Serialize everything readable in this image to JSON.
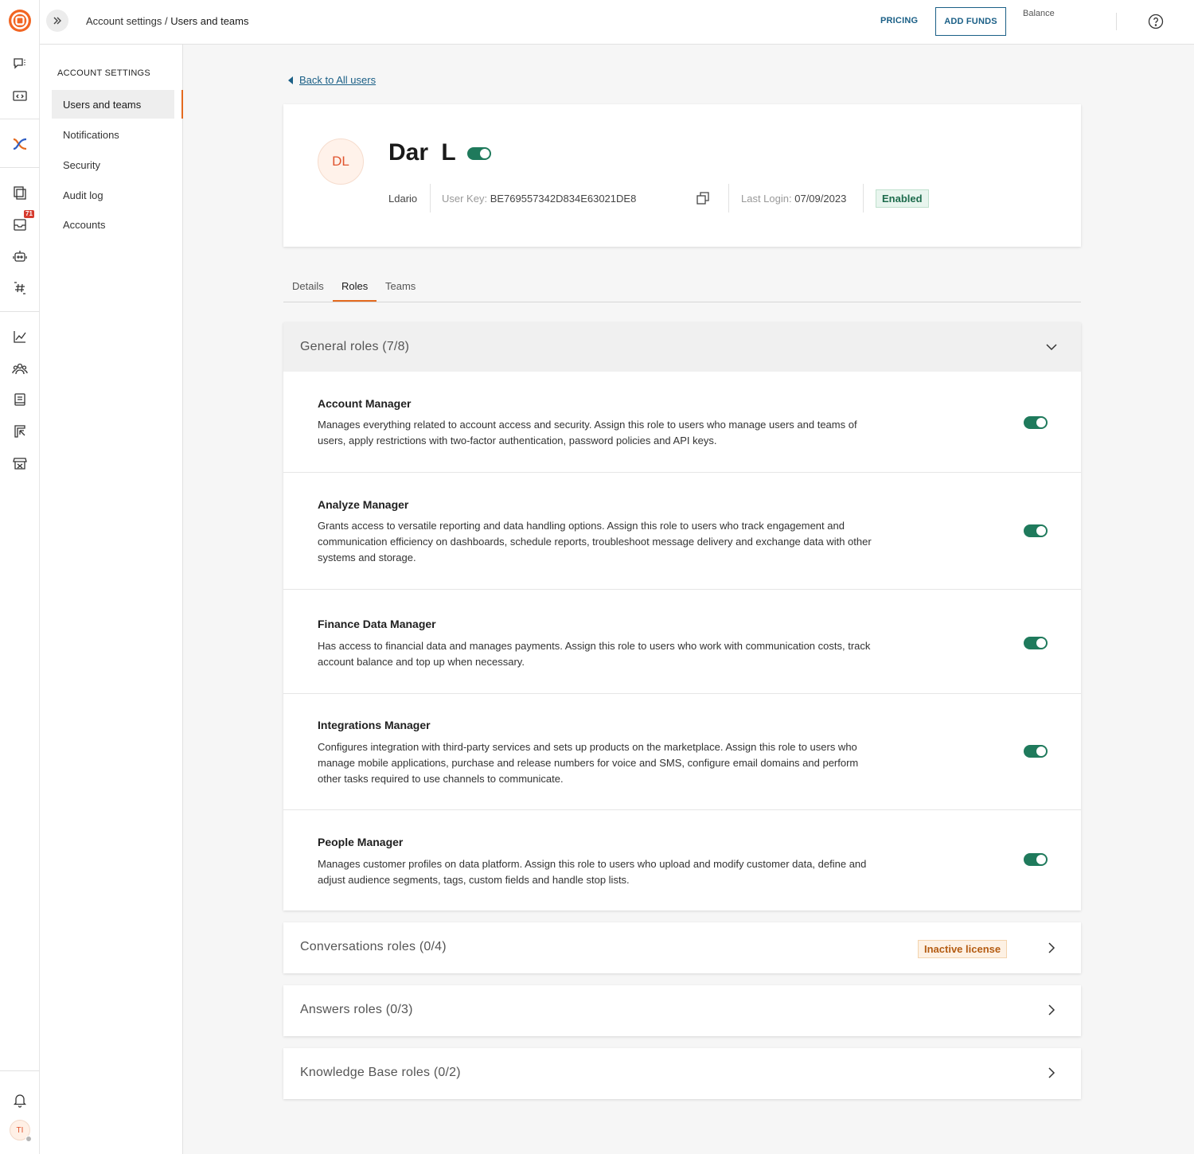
{
  "rail": {
    "icons": [
      "logo-icon",
      "conversations-icon",
      "developer-icon",
      "exchange-icon",
      "documents-icon",
      "inbox-icon",
      "bot-icon",
      "hashtag-icon",
      "analytics-icon",
      "people-icon",
      "knowledge-icon",
      "moments-icon",
      "marketplace-icon",
      "bell-icon"
    ],
    "badge": "71",
    "avatar_initials": "TI"
  },
  "topbar": {
    "breadcrumb_parent": "Account settings",
    "breadcrumb_separator": " / ",
    "breadcrumb_current": "Users and teams",
    "pricing": "PRICING",
    "add_funds": "ADD FUNDS",
    "balance_label": "Balance"
  },
  "sidebar": {
    "heading": "ACCOUNT SETTINGS",
    "items": [
      {
        "label": "Users and teams",
        "active": true
      },
      {
        "label": "Notifications"
      },
      {
        "label": "Security"
      },
      {
        "label": "Audit log"
      },
      {
        "label": "Accounts"
      }
    ]
  },
  "back_link": "Back to All users",
  "profile": {
    "initials": "DL",
    "name": "Dar L",
    "username": "Ldario",
    "user_key_label": "User Key:",
    "user_key": "BE769557342D834E63021DE8",
    "last_login_label": "Last Login:",
    "last_login": "07/09/2023",
    "status": "Enabled"
  },
  "tabs": [
    "Details",
    "Roles",
    "Teams"
  ],
  "active_tab": "Roles",
  "general_roles": {
    "title": "General roles (7/8)",
    "roles": [
      {
        "name": "Account Manager",
        "description": "Manages everything related to account access and security. Assign this role to users who manage users and teams of users, apply restrictions with two-factor authentication, password policies and API keys.",
        "enabled": true
      },
      {
        "name": "Analyze Manager",
        "description": "Grants access to versatile reporting and data handling options. Assign this role to users who track engagement and communication efficiency on dashboards, schedule reports, troubleshoot message delivery and exchange data with other systems and storage.",
        "enabled": true
      },
      {
        "name": "Finance Data Manager",
        "description": "Has access to financial data and manages payments. Assign this role to users who work with communication costs, track account balance and top up when necessary.",
        "enabled": true
      },
      {
        "name": "Integrations Manager",
        "description": "Configures integration with third-party services and sets up products on the marketplace. Assign this role to users who manage mobile applications, purchase and release numbers for voice and SMS, configure email domains and perform other tasks required to use channels to communicate.",
        "enabled": true
      },
      {
        "name": "People Manager",
        "description": "Manages customer profiles on data platform. Assign this role to users who upload and modify customer data, define and adjust audience segments, tags, custom fields and handle stop lists.",
        "enabled": true
      }
    ]
  },
  "other_groups": [
    {
      "title": "Conversations roles (0/4)",
      "badge": "Inactive license"
    },
    {
      "title": "Answers roles (0/3)"
    },
    {
      "title": "Knowledge Base roles (0/2)"
    }
  ],
  "colors": {
    "accent_orange": "#e46a1f",
    "link_blue": "#1a5f86",
    "toggle_green": "#1f7a5c",
    "enabled_bg": "#e8f5ee",
    "inactive_bg": "#fdf1e4"
  }
}
